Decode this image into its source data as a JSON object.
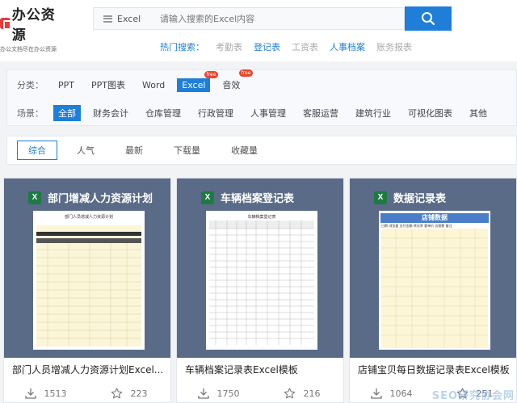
{
  "logo": {
    "title": "办公资源",
    "subtitle": "办公文档尽在办公资源"
  },
  "search": {
    "category": "Excel",
    "placeholder": "请输入搜索的Excel内容"
  },
  "hot": {
    "label": "热门搜索：",
    "items": [
      "考勤表",
      "登记表",
      "工资表",
      "人事档案",
      "账务报表"
    ]
  },
  "filter": {
    "category_label": "分类：",
    "categories": [
      "PPT",
      "PPT图表",
      "Word",
      "Excel",
      "音效"
    ],
    "free_badge": "free",
    "scene_label": "场景：",
    "scenes": [
      "全部",
      "财务会计",
      "仓库管理",
      "行政管理",
      "人事管理",
      "客服运营",
      "建筑行业",
      "可视化图表",
      "其他"
    ]
  },
  "sort": [
    "综合",
    "人气",
    "最新",
    "下载量",
    "收藏量"
  ],
  "cards": [
    {
      "head": "部门增减人力资源计划",
      "sheet_title": "部门人员增减人力资源计划",
      "title": "部门人员增减人力资源计划Excel...",
      "downloads": "1513",
      "favorites": "223"
    },
    {
      "head": "车辆档案登记表",
      "sheet_title": "车辆档案登记表",
      "title": "车辆档案记录表Excel模板",
      "downloads": "1750",
      "favorites": "216"
    },
    {
      "head": "数据记录表",
      "sheet_title": "店铺数据",
      "sheet_cols": "日期 浏览量 支付金额 转化率 客单价 访客数 备注",
      "title": "店铺宝贝每日数据记录表Excel模板",
      "downloads": "1064",
      "favorites": "251"
    }
  ],
  "watermark": "SEO研究协会网",
  "colors": {
    "accent": "#1e7ed8",
    "thumb_bg": "#5a6b87",
    "excel_green": "#1d7a44",
    "free_badge": "#e8472a"
  }
}
